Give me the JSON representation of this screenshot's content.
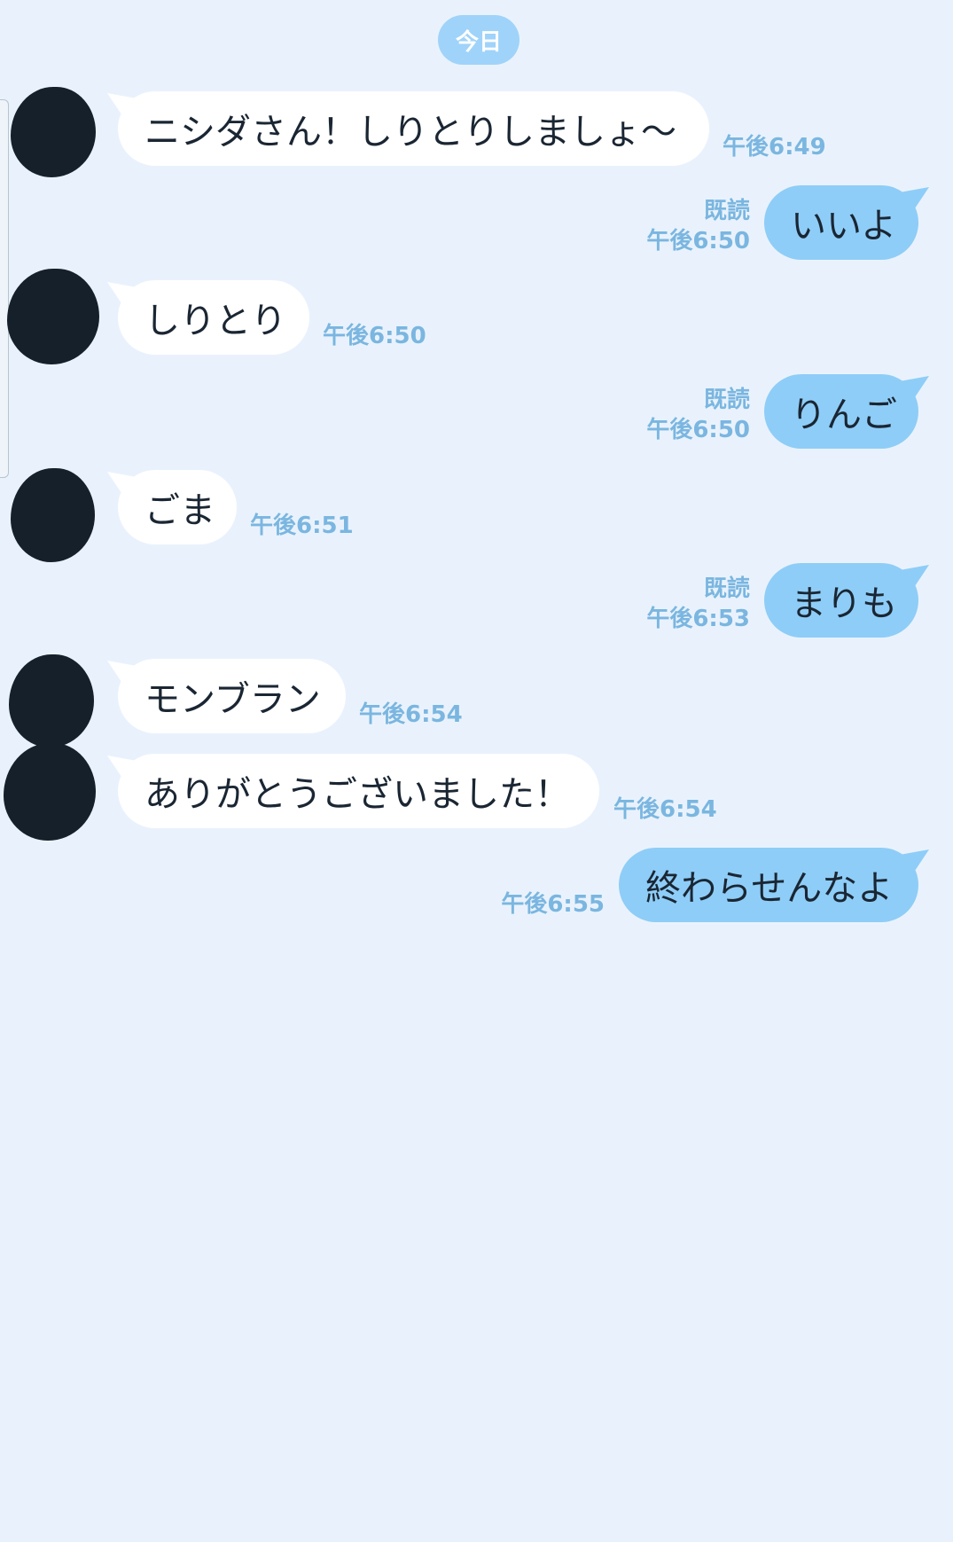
{
  "date_label": "今日",
  "messages": [
    {
      "side": "in",
      "text": "ニシダさん！しりとりしましょ〜",
      "time": "午後6:49"
    },
    {
      "side": "out",
      "text": "いいよ",
      "read": "既読",
      "time": "午後6:50"
    },
    {
      "side": "in",
      "text": "しりとり",
      "time": "午後6:50"
    },
    {
      "side": "out",
      "text": "りんご",
      "read": "既読",
      "time": "午後6:50"
    },
    {
      "side": "in",
      "text": "ごま",
      "time": "午後6:51"
    },
    {
      "side": "out",
      "text": "まりも",
      "read": "既読",
      "time": "午後6:53"
    },
    {
      "side": "in",
      "text": "モンブラン",
      "time": "午後6:54"
    },
    {
      "side": "in",
      "text": "ありがとうございました！",
      "time": "午後6:54"
    },
    {
      "side": "out",
      "text": "終わらせんなよ",
      "time": "午後6:55"
    }
  ],
  "colors": {
    "background": "#e9f2fc",
    "incoming_bubble": "#ffffff",
    "outgoing_bubble": "#8ecdf7",
    "meta_text": "#7ab6e0",
    "date_pill": "#9fd3fa",
    "avatar_redaction": "#15202b"
  }
}
